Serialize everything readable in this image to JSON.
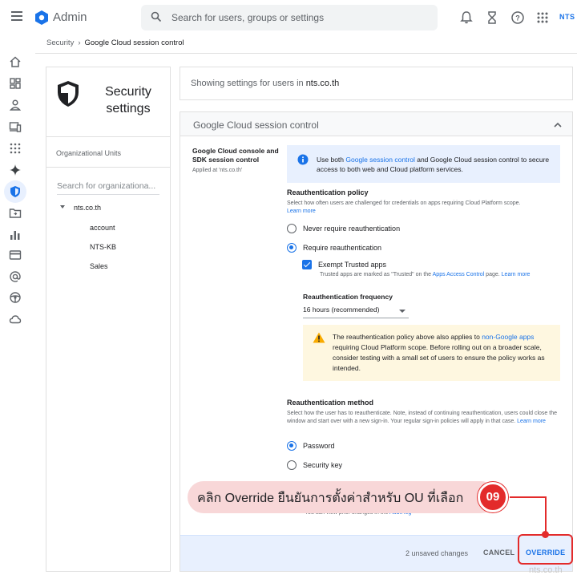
{
  "header": {
    "app_title": "Admin",
    "search_placeholder": "Search for users, groups or settings",
    "brand": "NTS"
  },
  "breadcrumb": {
    "parent": "Security",
    "current": "Google Cloud session control"
  },
  "left_panel": {
    "title": "Security settings",
    "ou_label": "Organizational Units",
    "ou_search_placeholder": "Search for organizationa...",
    "root": "nts.co.th",
    "children": [
      "account",
      "NTS-KB",
      "Sales"
    ]
  },
  "showing": {
    "prefix": "Showing settings for users in ",
    "domain": "nts.co.th"
  },
  "card": {
    "title": "Google Cloud session control",
    "setting_name": "Google Cloud console and SDK session control",
    "applied_at": "Applied at 'nts.co.th'",
    "info": {
      "pre": "Use both ",
      "link": "Google session control",
      "post": " and Google Cloud session control to secure access to both web and Cloud platform services."
    },
    "reauth_policy": {
      "title": "Reauthentication policy",
      "desc": "Select how often users are challenged for credentials on apps requiring Cloud Platform scope.",
      "learn_more": "Learn more",
      "options": [
        "Never require reauthentication",
        "Require reauthentication"
      ],
      "selected": "Require reauthentication",
      "exempt_label": "Exempt Trusted apps",
      "exempt_checked": true,
      "trusted_note_pre": "Trusted apps are marked as \"Trusted\" on the ",
      "trusted_note_link": "Apps Access Control",
      "trusted_note_mid": " page. ",
      "trusted_note_learn": "Learn more"
    },
    "frequency": {
      "title": "Reauthentication frequency",
      "value": "16 hours (recommended)"
    },
    "warning": {
      "pre": "The reauthentication policy above also applies to ",
      "link": "non-Google apps",
      "post": " requiring Cloud Platform scope. Before rolling out on a broader scale, consider testing with a small set of users to ensure the policy works as intended."
    },
    "reauth_method": {
      "title": "Reauthentication method",
      "desc": "Select how the user has to reauthenticate. Note, instead of continuing reauthentication, users could close the window and start over with a new sign-in. Your regular sign-in policies will apply in that case.",
      "learn_more": "Learn more",
      "options": [
        "Password",
        "Security key"
      ],
      "selected": "Password"
    },
    "audit_note_pre": "You can view prior changes in the ",
    "audit_note_link": "Audit log"
  },
  "footer": {
    "unsaved": "2 unsaved changes",
    "cancel": "CANCEL",
    "override": "OVERRIDE"
  },
  "annotation": {
    "callout": "คลิก Override ยืนยันการตั้งค่าสำหรับ OU ที่เลือก",
    "step": "09",
    "watermark": "nts.co.th"
  },
  "colors": {
    "accent": "#1a73e8",
    "annotation_red": "#e32b2b",
    "callout_bg": "#f8d7d8"
  }
}
